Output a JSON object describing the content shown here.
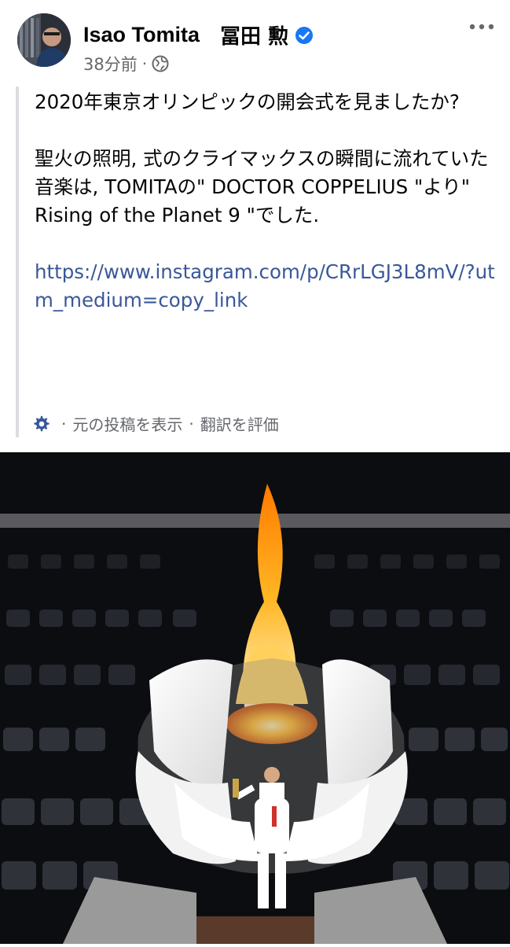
{
  "post": {
    "author_en": "Isao Tomita",
    "author_jp": "冨田 勲",
    "timestamp": "38分前",
    "meta_sep": "·",
    "paragraph1": "2020年東京オリンピックの開会式を見ましたか?",
    "paragraph2": "聖火の照明, 式のクライマックスの瞬間に流れていた音楽は, TOMITAの\" DOCTOR COPPELIUS \"より\" Rising of the Planet 9 \"でした.",
    "link": "https://www.instagram.com/p/CRrLGJ3L8mV/?utm_medium=copy_link"
  },
  "footer": {
    "sep": "·",
    "show_original": "元の投稿を表示",
    "rate_translation": "翻訳を評価"
  },
  "colors": {
    "verified_blue": "#1877f2",
    "link_blue": "#385898",
    "meta_gray": "#65676b"
  },
  "icons": [
    "more-options-icon",
    "verified-badge-icon",
    "globe-icon",
    "gear-icon"
  ]
}
